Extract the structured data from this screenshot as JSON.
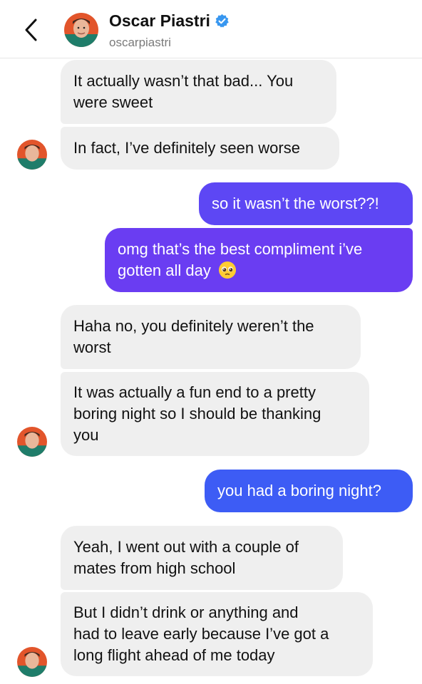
{
  "header": {
    "name": "Oscar Piastri",
    "handle": "oscarpiastri"
  },
  "colors": {
    "incoming_bubble": "#efefef",
    "outgoing_purple": "#6a3df2",
    "outgoing_blue": "#3d5cf5",
    "verified_blue": "#3897f0"
  },
  "messages": [
    {
      "from": "contact",
      "lines": [
        "It actually wasn’t that bad... You",
        "were sweet"
      ]
    },
    {
      "from": "contact",
      "lines": [
        "In fact, I’ve definitely seen worse"
      ]
    },
    {
      "from": "me",
      "lines": [
        "so it wasn’t the worst??!"
      ]
    },
    {
      "from": "me",
      "lines": [
        "omg that’s the best compliment i’ve",
        "gotten all day"
      ],
      "emoji": "pleading-face-emoji"
    },
    {
      "from": "contact",
      "lines": [
        "Haha no, you definitely weren’t the",
        "worst"
      ]
    },
    {
      "from": "contact",
      "lines": [
        "It was actually a fun end to a pretty",
        "boring night so I should be thanking",
        "you"
      ]
    },
    {
      "from": "me",
      "lines": [
        "you had a boring night?"
      ]
    },
    {
      "from": "contact",
      "lines": [
        "Yeah, I went out with a couple of",
        "mates from high school"
      ]
    },
    {
      "from": "contact",
      "lines": [
        "But I didn’t drink or anything and",
        "had to leave early because I’ve got a",
        "long flight ahead of me today"
      ]
    }
  ]
}
